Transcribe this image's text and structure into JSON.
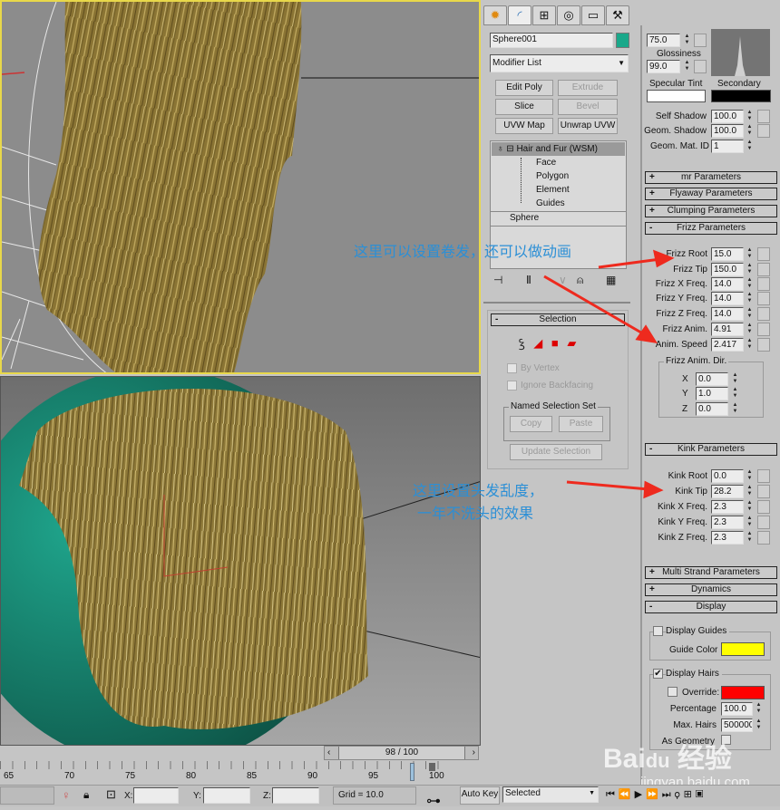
{
  "command_panel": {
    "tabs": [
      "create-icon",
      "modify-icon",
      "hierarchy-icon",
      "motion-icon",
      "display-icon",
      "utilities-icon"
    ],
    "object_name": "Sphere001",
    "object_color": "#1aa88a",
    "modifier_list": "Modifier List",
    "buttons": [
      {
        "label": "Edit Poly",
        "enabled": true
      },
      {
        "label": "Extrude",
        "enabled": false
      },
      {
        "label": "Slice",
        "enabled": true
      },
      {
        "label": "Bevel",
        "enabled": false
      },
      {
        "label": "UVW Map",
        "enabled": true
      },
      {
        "label": "Unwrap UVW",
        "enabled": true
      }
    ],
    "stack": {
      "modifier": "Hair and Fur (WSM)",
      "subobjects": [
        "Face",
        "Polygon",
        "Element",
        "Guides"
      ],
      "base": "Sphere"
    },
    "selection": {
      "title": "Selection",
      "by_vertex": "By Vertex",
      "ignore_backfacing": "Ignore Backfacing",
      "named_set": "Named Selection Set",
      "copy": "Copy",
      "paste": "Paste",
      "update": "Update Selection"
    }
  },
  "params": {
    "specular_value": "75.0",
    "glossiness_label": "Glossiness",
    "glossiness": "99.0",
    "specular_tint_label": "Specular Tint",
    "secondary_label": "Secondary",
    "specular_tint_color": "#ffffff",
    "secondary_color": "#000000",
    "self_shadow_label": "Self Shadow",
    "self_shadow": "100.0",
    "geom_shadow_label": "Geom. Shadow",
    "geom_shadow": "100.0",
    "geom_mat_id_label": "Geom. Mat. ID",
    "geom_mat_id": "1",
    "rollouts": {
      "mr": "mr Parameters",
      "flyaway": "Flyaway Parameters",
      "clumping": "Clumping Parameters",
      "frizz": "Frizz Parameters",
      "kink": "Kink Parameters",
      "multi": "Multi Strand Parameters",
      "dynamics": "Dynamics",
      "display": "Display"
    },
    "frizz": [
      {
        "label": "Frizz Root",
        "value": "15.0"
      },
      {
        "label": "Frizz Tip",
        "value": "150.0"
      },
      {
        "label": "Frizz X Freq.",
        "value": "14.0"
      },
      {
        "label": "Frizz Y Freq.",
        "value": "14.0"
      },
      {
        "label": "Frizz Z Freq.",
        "value": "14.0"
      },
      {
        "label": "Frizz Anim.",
        "value": "4.91"
      },
      {
        "label": "Anim. Speed",
        "value": "2.417"
      }
    ],
    "frizz_dir": {
      "title": "Frizz Anim. Dir.",
      "x_label": "X",
      "x": "0.0",
      "y_label": "Y",
      "y": "1.0",
      "z_label": "Z",
      "z": "0.0"
    },
    "kink": [
      {
        "label": "Kink Root",
        "value": "0.0"
      },
      {
        "label": "Kink Tip",
        "value": "28.2"
      },
      {
        "label": "Kink X Freq.",
        "value": "2.3"
      },
      {
        "label": "Kink Y Freq.",
        "value": "2.3"
      },
      {
        "label": "Kink Z Freq.",
        "value": "2.3"
      }
    ],
    "display": {
      "display_guides": "Display Guides",
      "display_guides_checked": false,
      "guide_color_label": "Guide Color",
      "guide_color": "#ffff00",
      "display_hairs": "Display Hairs",
      "display_hairs_checked": true,
      "override": "Override:",
      "override_checked": false,
      "override_color": "#ff0000",
      "percentage_label": "Percentage",
      "percentage": "100.0",
      "max_hairs_label": "Max. Hairs",
      "max_hairs": "500000",
      "as_geometry": "As Geometry"
    }
  },
  "annotations": {
    "frizz_note": "这里可以设置卷发，还可以做动画",
    "kink_note_1": "这里设置头发乱度，",
    "kink_note_2": "一年不洗头的效果"
  },
  "timeline": {
    "frame": "98 / 100",
    "ticks": [
      "65",
      "70",
      "75",
      "80",
      "85",
      "90",
      "95",
      "100"
    ]
  },
  "status": {
    "x_label": "X:",
    "y_label": "Y:",
    "z_label": "Z:",
    "grid": "Grid = 10.0",
    "auto_key": "Auto Key",
    "key_filter": "Selected"
  },
  "watermark": {
    "logo": "Bai du 经验",
    "url": "jingyan.baidu.com"
  }
}
